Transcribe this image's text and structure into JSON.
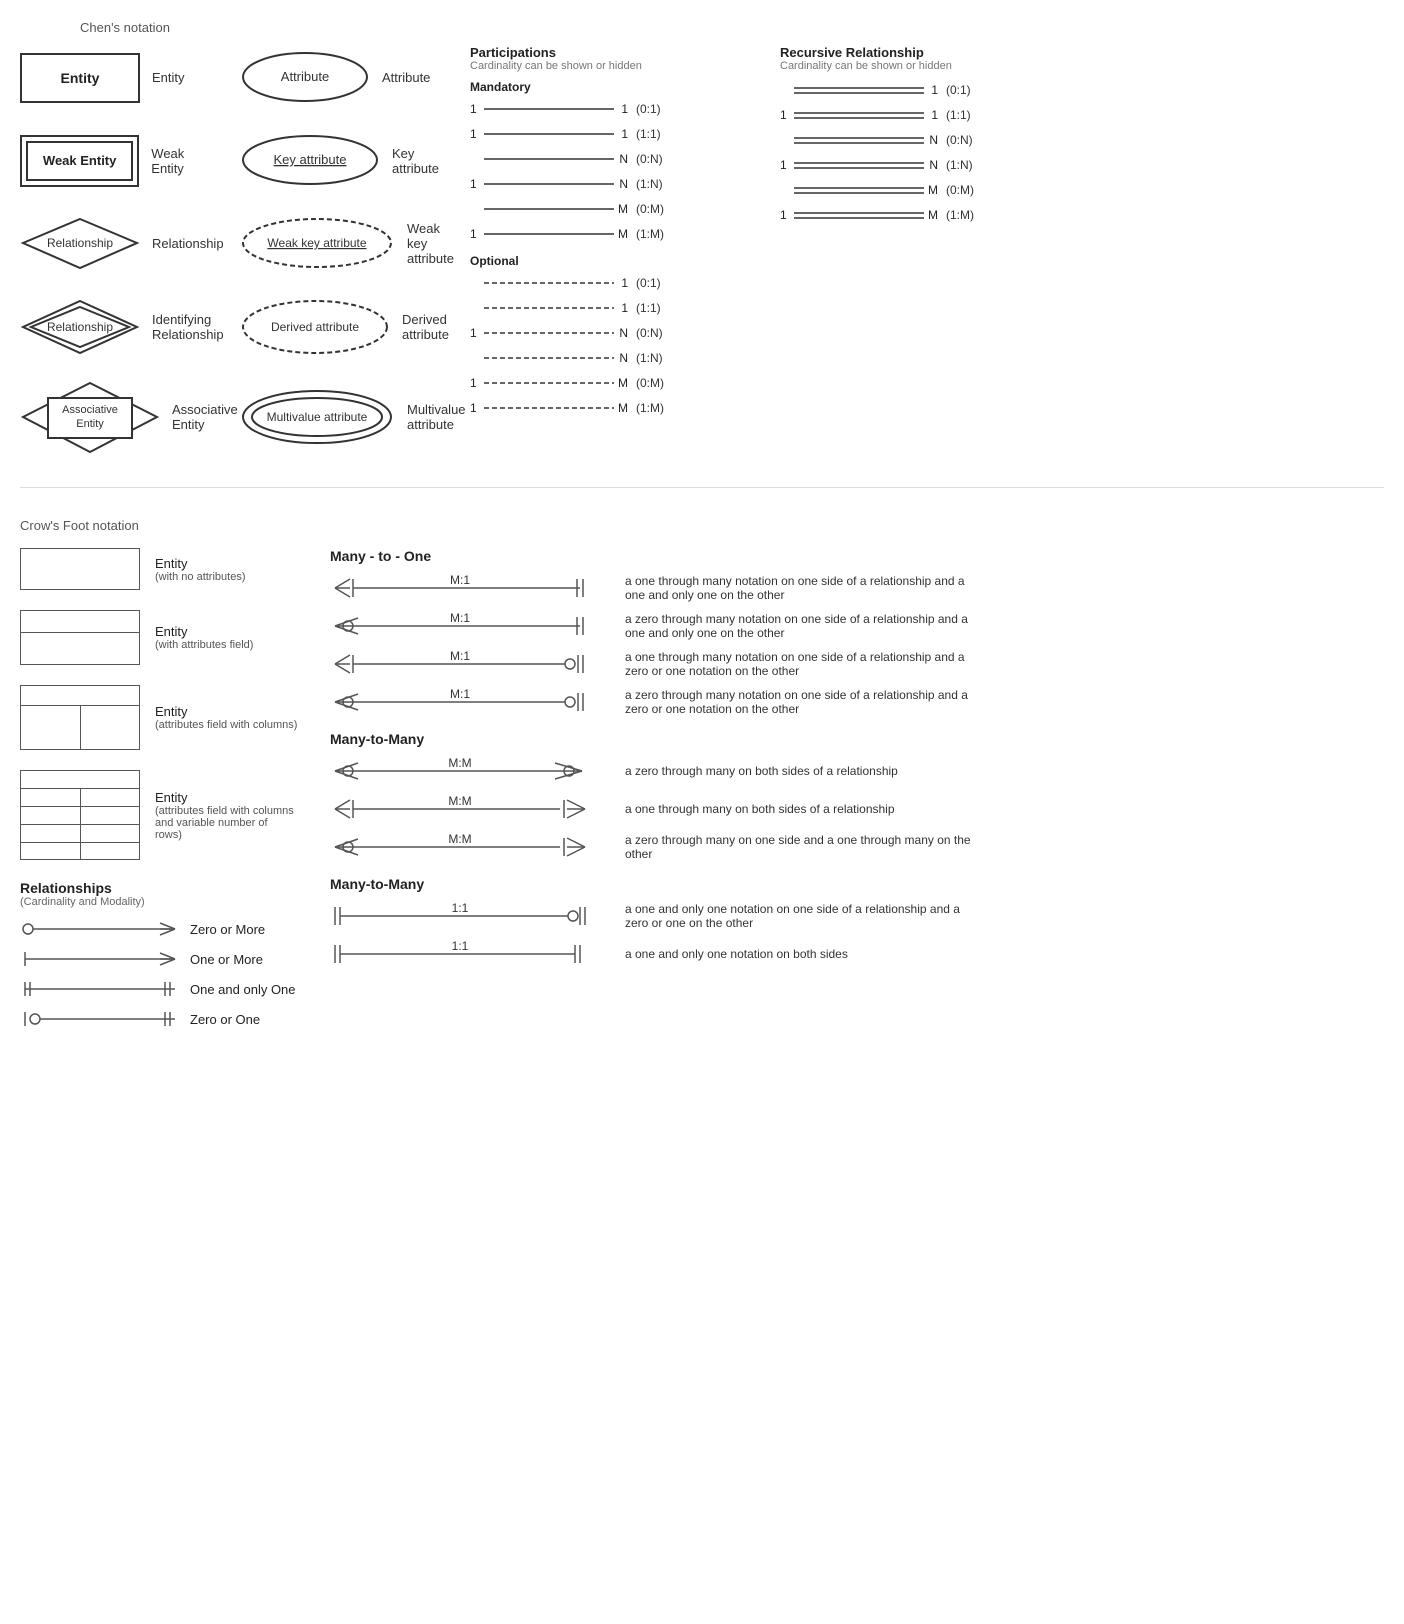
{
  "chens": {
    "title": "Chen's notation",
    "entities": [
      {
        "label": "Entity",
        "name": "Entity"
      },
      {
        "label": "Weak Entity",
        "name": "Weak Entity"
      },
      {
        "label": "Relationship",
        "name": "Relationship"
      },
      {
        "label": "Identifying Relationship",
        "name": "Relationship"
      },
      {
        "label": "Associative Entity",
        "name": "Associative\nEntity"
      }
    ],
    "attributes": [
      {
        "label": "Attribute",
        "name": "Attribute"
      },
      {
        "label": "Key attribute",
        "name": "Key attribute"
      },
      {
        "label": "Weak key attribute",
        "name": "Weak key attribute"
      },
      {
        "label": "Derived attribute",
        "name": "Derived attribute"
      },
      {
        "label": "Multivalue attribute",
        "name": "Multivalue attribute"
      }
    ]
  },
  "participations": {
    "title": "Participations",
    "subtitle": "Cardinality can be shown or hidden",
    "mandatory_label": "Mandatory",
    "optional_label": "Optional",
    "mandatory_rows": [
      {
        "left": "1",
        "right": "1",
        "notation": "(0:1)"
      },
      {
        "left": "1",
        "right": "1",
        "notation": "(1:1)"
      },
      {
        "left": "",
        "right": "N",
        "notation": "(0:N)"
      },
      {
        "left": "1",
        "right": "N",
        "notation": "(1:N)"
      },
      {
        "left": "",
        "right": "M",
        "notation": "(0:M)"
      },
      {
        "left": "1",
        "right": "M",
        "notation": "(1:M)"
      }
    ],
    "optional_rows": [
      {
        "left": "",
        "right": "1",
        "notation": "(0:1)"
      },
      {
        "left": "",
        "right": "1",
        "notation": "(1:1)"
      },
      {
        "left": "1",
        "right": "N",
        "notation": "(0:N)"
      },
      {
        "left": "",
        "right": "N",
        "notation": "(1:N)"
      },
      {
        "left": "1",
        "right": "M",
        "notation": "(0:M)"
      },
      {
        "left": "1",
        "right": "M",
        "notation": "(1:M)"
      }
    ]
  },
  "recursive": {
    "title": "Recursive Relationship",
    "subtitle": "Cardinality can be shown or hidden",
    "rows": [
      {
        "right": "1",
        "notation": "(0:1)"
      },
      {
        "left": "1",
        "right": "1",
        "notation": "(1:1)"
      },
      {
        "right": "N",
        "notation": "(0:N)"
      },
      {
        "left": "1",
        "right": "N",
        "notation": "(1:N)"
      },
      {
        "right": "M",
        "notation": "(0:M)"
      },
      {
        "left": "1",
        "right": "M",
        "notation": "(1:M)"
      }
    ]
  },
  "crows": {
    "title": "Crow's Foot notation",
    "entities": [
      {
        "label": "Entity",
        "sub": "(with no attributes)"
      },
      {
        "label": "Entity",
        "sub": "(with attributes field)"
      },
      {
        "label": "Entity",
        "sub": "(attributes field with columns)"
      },
      {
        "label": "Entity",
        "sub": "(attributes field with columns and\nvariable number of rows)"
      }
    ],
    "many_to_one_title": "Many - to - One",
    "many_to_many_title": "Many-to-Many",
    "many_to_many2_title": "Many-to-Many",
    "many_to_one_rows": [
      {
        "label": "M:1",
        "desc": "a one through many notation on one side of a relationship and a one and only one on the other"
      },
      {
        "label": "M:1",
        "desc": "a zero through many notation on one side of a relationship and a one and only one on the other"
      },
      {
        "label": "M:1",
        "desc": "a one through many notation on one side of a relationship and a zero or one notation on the other"
      },
      {
        "label": "M:1",
        "desc": "a zero through many notation on one side of a relationship and a zero or one notation on the other"
      }
    ],
    "many_to_many_rows": [
      {
        "label": "M:M",
        "desc": "a zero through many on both sides of a relationship"
      },
      {
        "label": "M:M",
        "desc": "a one through many on both sides of a relationship"
      },
      {
        "label": "M:M",
        "desc": "a zero through many on one side and a one through many on the other"
      }
    ],
    "one_to_one_rows": [
      {
        "label": "1:1",
        "desc": "a one and only one notation on one side of a relationship and a zero or one on the other"
      },
      {
        "label": "1:1",
        "desc": "a one and only one notation on both sides"
      }
    ]
  },
  "relationships": {
    "title": "Relationships",
    "subtitle": "(Cardinality and Modality)",
    "items": [
      {
        "symbol": "zero_or_more",
        "label": "Zero or More"
      },
      {
        "symbol": "one_or_more",
        "label": "One or More"
      },
      {
        "symbol": "one_only",
        "label": "One and only One"
      },
      {
        "symbol": "zero_or_one",
        "label": "Zero or One"
      }
    ]
  }
}
